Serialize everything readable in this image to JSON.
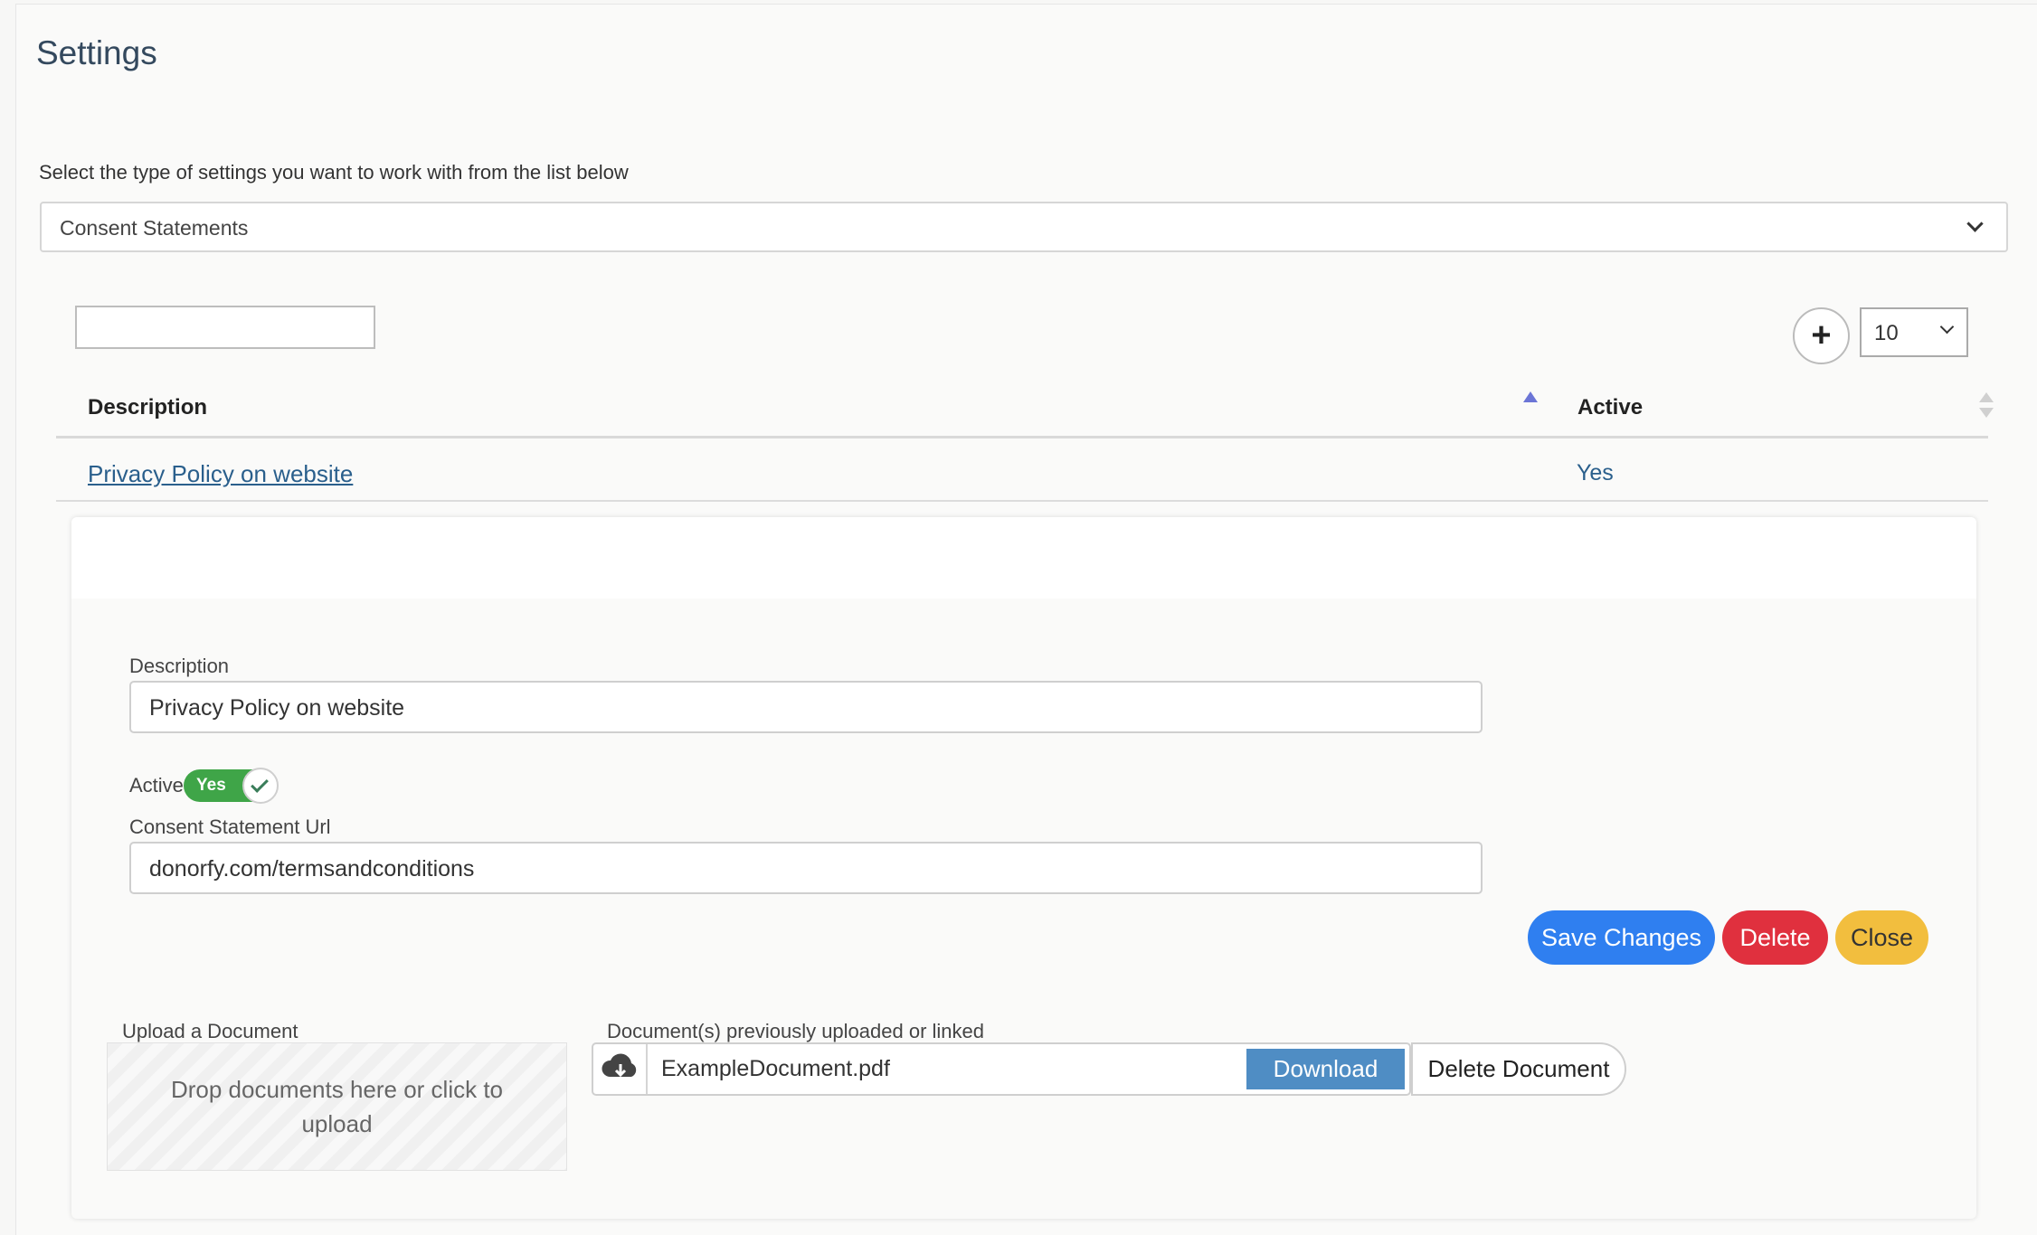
{
  "header": {
    "title": "Settings"
  },
  "settings_type": {
    "prompt": "Select the type of settings you want to work with from the list below",
    "selected": "Consent Statements"
  },
  "table": {
    "search_value": "",
    "page_size": "10",
    "columns": {
      "description": "Description",
      "active": "Active"
    },
    "rows": [
      {
        "description": "Privacy Policy on website",
        "active": "Yes"
      }
    ]
  },
  "form": {
    "description_label": "Description",
    "description_value": "Privacy Policy on website",
    "active_label": "Active",
    "active_value": "Yes",
    "url_label": "Consent Statement Url",
    "url_value": "donorfy.com/termsandconditions",
    "save_label": "Save Changes",
    "delete_label": "Delete",
    "close_label": "Close"
  },
  "documents": {
    "upload_label": "Upload a Document",
    "dropzone_text": "Drop documents here or click to upload",
    "previous_label": "Document(s) previously uploaded or linked",
    "file_name": "ExampleDocument.pdf",
    "download_label": "Download",
    "delete_doc_label": "Delete Document"
  },
  "colors": {
    "primary": "#2f7ff0",
    "danger": "#e0303e",
    "warning": "#f2be3e",
    "success": "#3fa548",
    "link": "#2a5f8c"
  },
  "icons": {
    "add": "plus-icon",
    "dropdown": "chevron-down-icon",
    "cloud": "cloud-download-icon",
    "check": "check-icon"
  }
}
